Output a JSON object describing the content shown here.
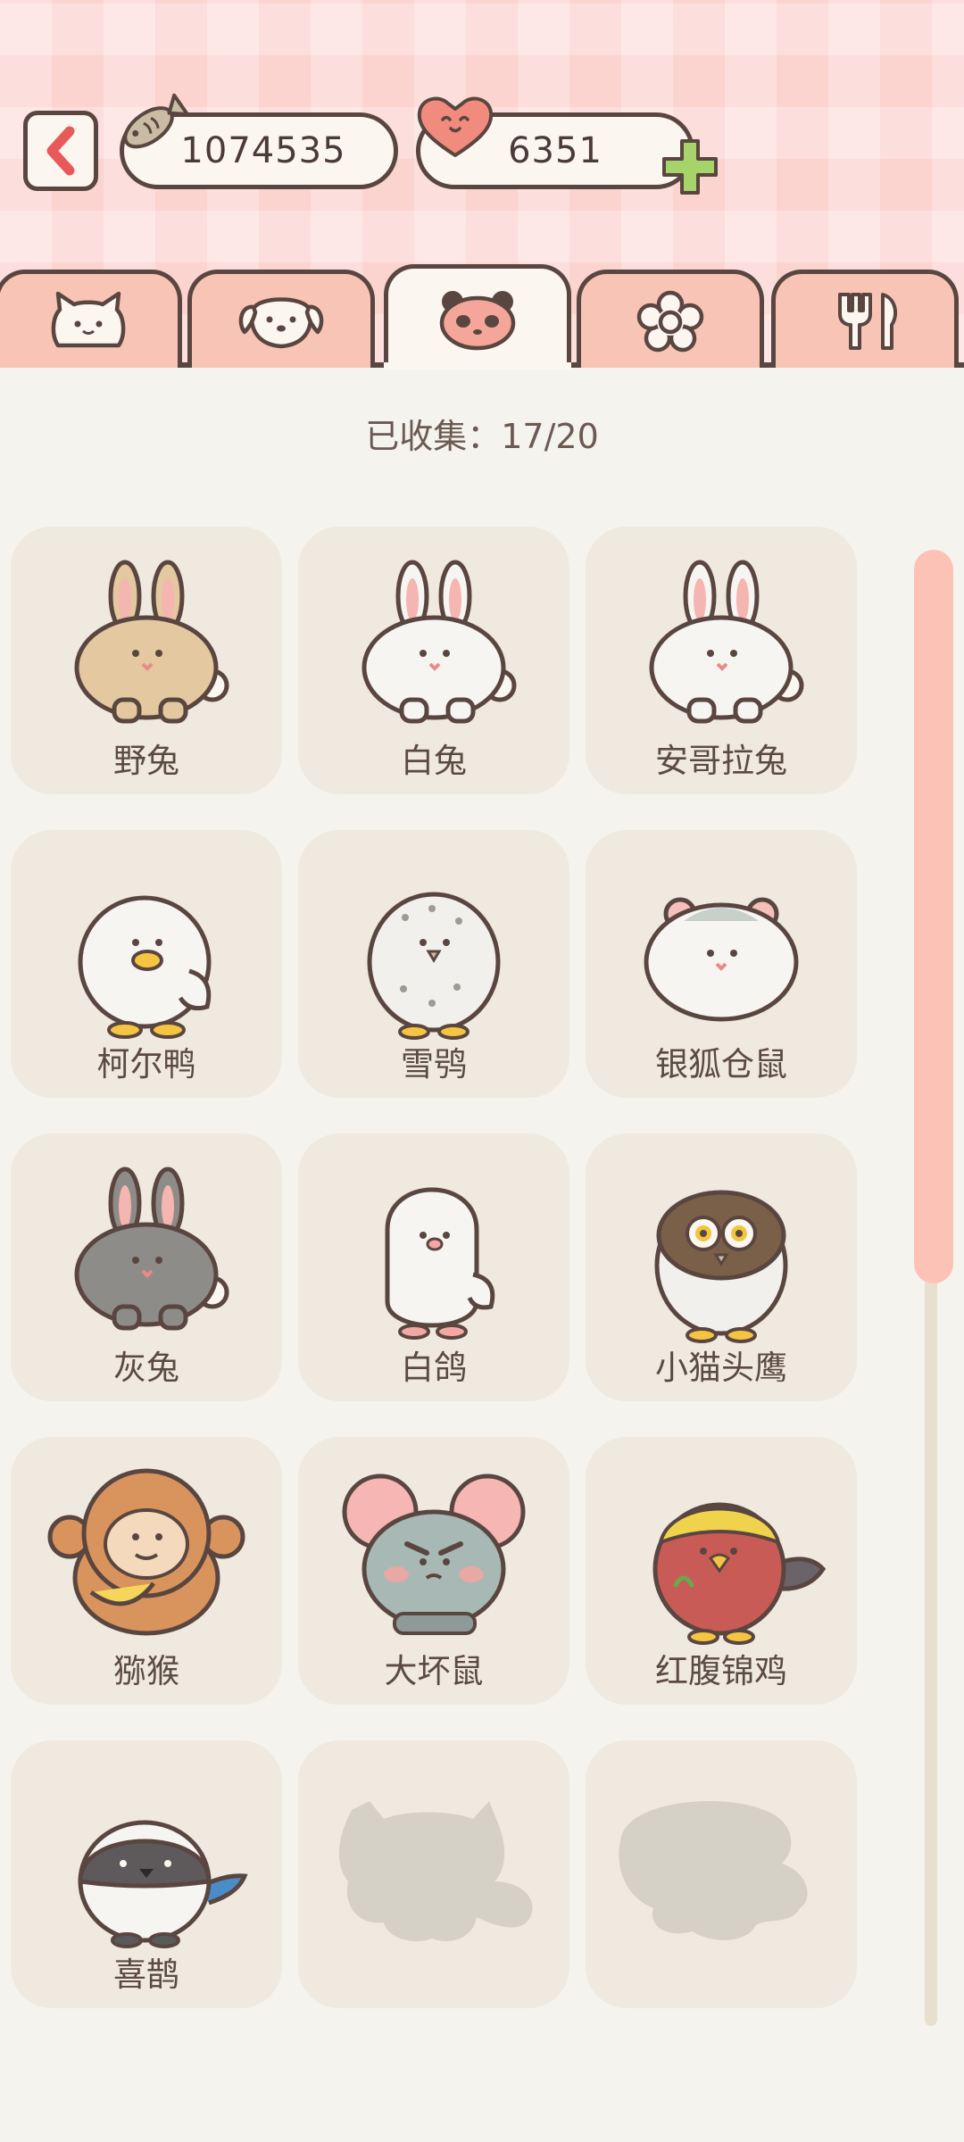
{
  "header": {
    "fish_count": "1074535",
    "heart_count": "6351"
  },
  "tabs": [
    {
      "icon": "cat-icon",
      "active": false
    },
    {
      "icon": "dog-icon",
      "active": false
    },
    {
      "icon": "panda-icon",
      "active": true
    },
    {
      "icon": "flower-icon",
      "active": false
    },
    {
      "icon": "fork-knife-icon",
      "active": false
    }
  ],
  "collection": {
    "label": "已收集：17/20"
  },
  "animals": [
    {
      "name": "野兔",
      "kind": "rabbit",
      "color": "#e3c8a0",
      "unlocked": true
    },
    {
      "name": "白兔",
      "kind": "rabbit",
      "color": "#f7f5f2",
      "unlocked": true
    },
    {
      "name": "安哥拉兔",
      "kind": "rabbit",
      "color": "#f7f5f2",
      "unlocked": true
    },
    {
      "name": "柯尔鸭",
      "kind": "duck",
      "color": "#f7f5f2",
      "unlocked": true
    },
    {
      "name": "雪鸮",
      "kind": "owl",
      "color": "#f0eeea",
      "unlocked": true
    },
    {
      "name": "银狐仓鼠",
      "kind": "hamster",
      "color": "#f7f5f2",
      "unlocked": true
    },
    {
      "name": "灰兔",
      "kind": "rabbit",
      "color": "#8e8c88",
      "unlocked": true
    },
    {
      "name": "白鸽",
      "kind": "bird",
      "color": "#f7f5f2",
      "unlocked": true
    },
    {
      "name": "小猫头鹰",
      "kind": "owl",
      "color": "#7a6048",
      "unlocked": true
    },
    {
      "name": "猕猴",
      "kind": "monkey",
      "color": "#d8945c",
      "unlocked": true
    },
    {
      "name": "大坏鼠",
      "kind": "mouse",
      "color": "#a8b8b4",
      "unlocked": true
    },
    {
      "name": "红腹锦鸡",
      "kind": "parrot",
      "color": "#c85b56",
      "unlocked": true
    },
    {
      "name": "喜鹊",
      "kind": "magpie",
      "color": "#5e5a5c",
      "unlocked": true
    },
    {
      "name": "",
      "kind": "silhouette-cat",
      "color": "#d6d1c6",
      "unlocked": false
    },
    {
      "name": "",
      "kind": "silhouette-blob",
      "color": "#d6d1c6",
      "unlocked": false
    }
  ],
  "colors": {
    "outline": "#5a4640",
    "tab_inactive": "#f8c4b6",
    "card_bg": "#efe9df",
    "accent_green": "#a6d46a",
    "back_arrow": "#e85a5a"
  }
}
